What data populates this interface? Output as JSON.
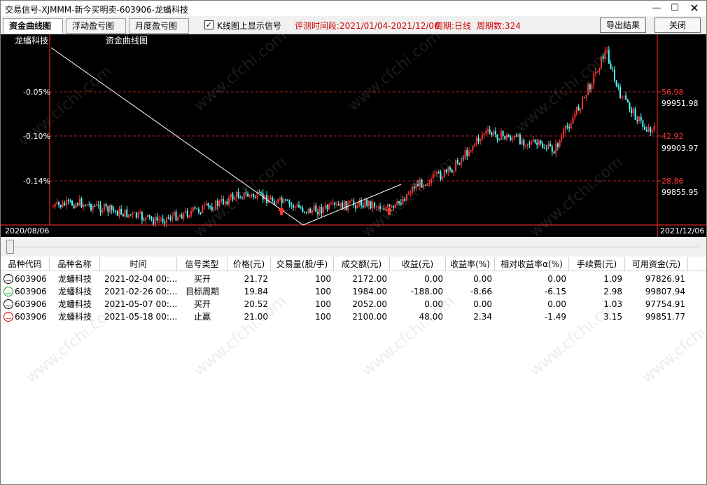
{
  "window": {
    "title": "交易信号-XJMMM-新今买明卖-603906-龙蟠科技",
    "controls": [
      "minimize",
      "maximize",
      "close"
    ]
  },
  "toolbar": {
    "tabs": [
      {
        "label": "资金曲线图",
        "active": true
      },
      {
        "label": "浮动盈亏图",
        "active": false
      },
      {
        "label": "月度盈亏图",
        "active": false
      }
    ],
    "show_signal_checkbox": {
      "label": "K线图上显示信号",
      "checked": true
    },
    "eval_period": "评测时间段:2021/01/04-2021/12/06",
    "cycle": "周期:日线",
    "cycle_count": "周期数:324",
    "export_label": "导出结果",
    "close_label": "关闭"
  },
  "chart": {
    "stock_name": "龙蟠科技",
    "chart_title": "资金曲线图",
    "left_axis_labels": [
      "-0.05%",
      "-0.10%",
      "-0.14%"
    ],
    "right_price_labels": [
      "56.98",
      "42.92",
      "28.86"
    ],
    "right_equity_labels": [
      "99951.98",
      "99903.97",
      "99855.95"
    ],
    "start_date": "2020/08/06",
    "end_date": "2021/12/06",
    "colors": {
      "up": "#ff3232",
      "down": "#54ffff",
      "grid": "#ff3232",
      "equity": "#ffffff",
      "bg": "#000000"
    },
    "watermark": "www.cfchi.com"
  },
  "table": {
    "columns": [
      "品种代码",
      "品种名称",
      "时间",
      "信号类型",
      "价格(元)",
      "交易量(股/手)",
      "成交额(元)",
      "收益(元)",
      "收益率(%)",
      "相对收益率α(%)",
      "手续费(元)",
      "可用资金(元)"
    ],
    "rows": [
      {
        "icon": "smile-icon",
        "code": "603906",
        "name": "龙蟠科技",
        "time": "2021-02-04 00:...",
        "type": "买开",
        "price": "21.72",
        "volume": "100",
        "amount": "2172.00",
        "profit": "0.00",
        "rate": "0.00",
        "alpha": "0.00",
        "fee": "1.09",
        "cash": "97826.91"
      },
      {
        "icon": "green-face-icon",
        "code": "603906",
        "name": "龙蟠科技",
        "time": "2021-02-26 00:...",
        "type": "目标周期",
        "price": "19.84",
        "volume": "100",
        "amount": "1984.00",
        "profit": "-188.00",
        "rate": "-8.66",
        "alpha": "-6.15",
        "fee": "2.98",
        "cash": "99807.94"
      },
      {
        "icon": "smile-icon",
        "code": "603906",
        "name": "龙蟠科技",
        "time": "2021-05-07 00:...",
        "type": "买开",
        "price": "20.52",
        "volume": "100",
        "amount": "2052.00",
        "profit": "0.00",
        "rate": "0.00",
        "alpha": "0.00",
        "fee": "1.03",
        "cash": "97754.91"
      },
      {
        "icon": "red-face-icon",
        "code": "603906",
        "name": "龙蟠科技",
        "time": "2021-05-18 00:...",
        "type": "止赢",
        "price": "21.00",
        "volume": "100",
        "amount": "2100.00",
        "profit": "48.00",
        "rate": "2.34",
        "alpha": "-1.49",
        "fee": "3.15",
        "cash": "99851.77"
      }
    ]
  }
}
